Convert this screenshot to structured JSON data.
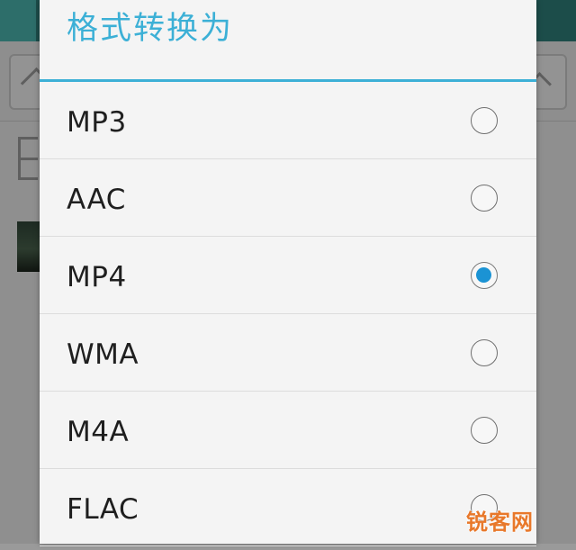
{
  "dialog": {
    "title": "格式转换为",
    "options": [
      {
        "label": "MP3",
        "selected": false
      },
      {
        "label": "AAC",
        "selected": false
      },
      {
        "label": "MP4",
        "selected": true
      },
      {
        "label": "WMA",
        "selected": false
      },
      {
        "label": "M4A",
        "selected": false
      },
      {
        "label": "FLAC",
        "selected": false
      }
    ]
  },
  "watermark": {
    "text": "锐客网"
  },
  "icons": {
    "home": "home-icon",
    "up": "up-arrow-icon",
    "folder": "folder-icon",
    "radio": "radio-button-icon"
  },
  "colors": {
    "accent": "#3cb0d6",
    "radio_checked": "#1b93d4",
    "watermark": "#e8782a",
    "dialog_bg": "#f4f4f4"
  }
}
